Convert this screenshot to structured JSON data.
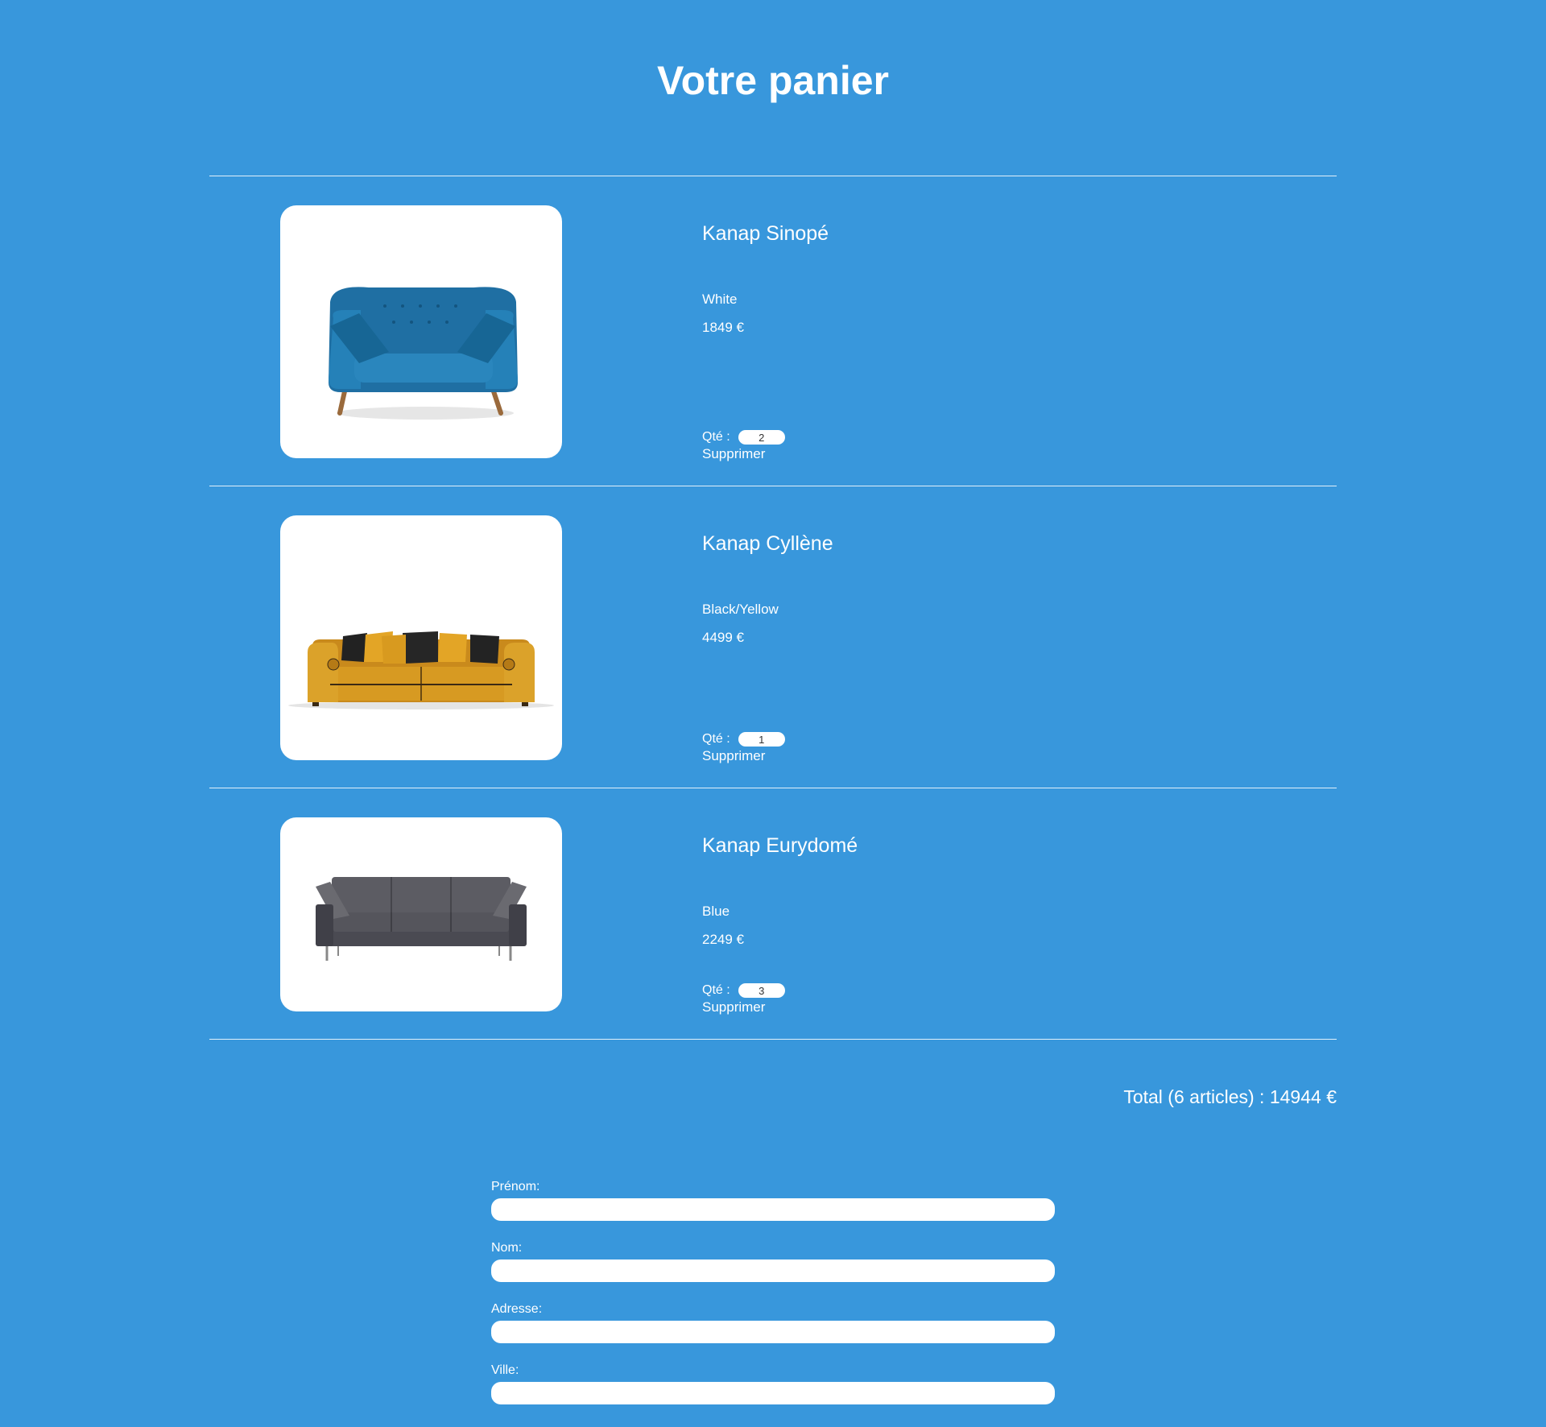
{
  "page": {
    "title": "Votre panier"
  },
  "cart": {
    "items": [
      {
        "name": "Kanap Sinopé",
        "color": "White",
        "price": "1849 €",
        "qty_label": "Qté :",
        "quantity": "2",
        "delete_label": "Supprimer",
        "image": "blue-sofa"
      },
      {
        "name": "Kanap Cyllène",
        "color": "Black/Yellow",
        "price": "4499 €",
        "qty_label": "Qté :",
        "quantity": "1",
        "delete_label": "Supprimer",
        "image": "yellow-sofa"
      },
      {
        "name": "Kanap Eurydomé",
        "color": "Blue",
        "price": "2249 €",
        "qty_label": "Qté :",
        "quantity": "3",
        "delete_label": "Supprimer",
        "image": "grey-sofa"
      }
    ],
    "total": {
      "prefix": "Total (",
      "count": "6",
      "middle": " articles) : ",
      "price": "14944",
      "currency": " €"
    }
  },
  "form": {
    "first_name_label": "Prénom:",
    "last_name_label": "Nom:",
    "address_label": "Adresse:",
    "city_label": "Ville:"
  },
  "colors": {
    "background": "#3897dc",
    "text": "#ffffff"
  }
}
